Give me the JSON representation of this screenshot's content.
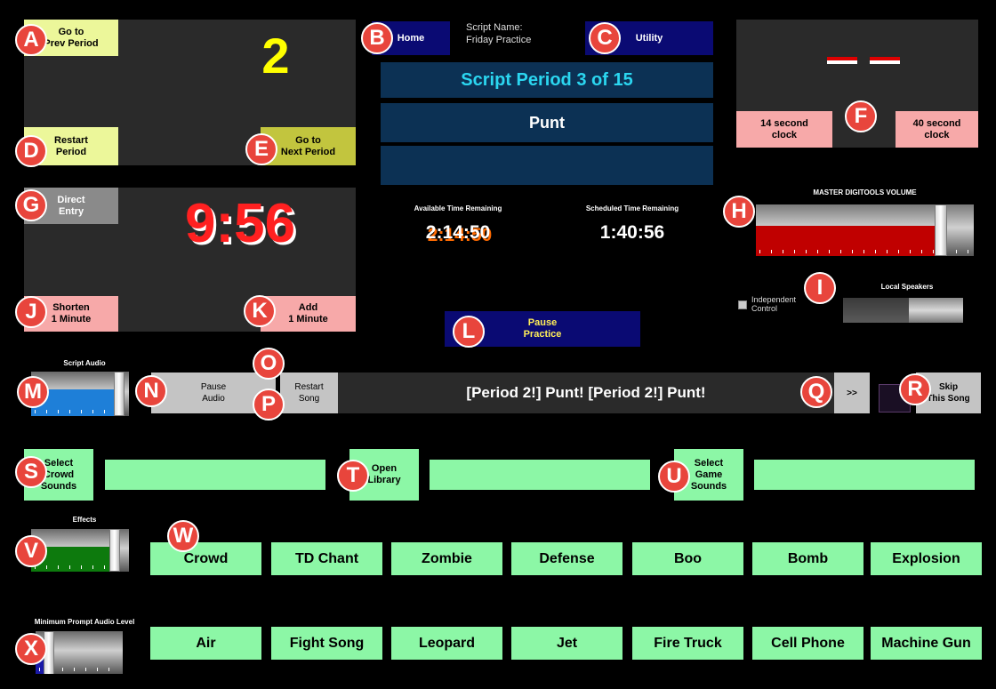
{
  "badges": [
    "A",
    "B",
    "C",
    "D",
    "E",
    "F",
    "G",
    "H",
    "I",
    "J",
    "K",
    "L",
    "M",
    "N",
    "O",
    "P",
    "Q",
    "R",
    "S",
    "T",
    "U",
    "V",
    "W",
    "X"
  ],
  "period": {
    "prev_label": "Go to\nPrev Period",
    "number": "2",
    "restart_label": "Restart\nPeriod",
    "next_label": "Go to\nNext Period"
  },
  "header": {
    "home_label": "Home",
    "script_name_label": "Script Name:",
    "script_name_value": "Friday Practice",
    "utility_label": "Utility"
  },
  "script": {
    "period_text": "Script Period 3 of 15",
    "period_name": "Punt",
    "extra": ""
  },
  "clocks": {
    "dashes": "– –",
    "fourteen_label": "14 second\nclock",
    "forty_label": "40 second\nclock"
  },
  "timer": {
    "direct_entry_label": "Direct\nEntry",
    "value": "9:56",
    "shorten_label": "Shorten\n1 Minute",
    "add_label": "Add\n1 Minute"
  },
  "time_remaining": {
    "available_label": "Available Time Remaining",
    "available_value": "2:14:50",
    "scheduled_label": "Scheduled Time Remaining",
    "scheduled_value": "1:40:56"
  },
  "master_volume": {
    "label": "MASTER DIGITOOLS VOLUME",
    "level": 0.85,
    "color": "#c00000"
  },
  "local_speakers": {
    "label": "Local Speakers",
    "independent_label": "Independent\nControl",
    "checked": false,
    "level": 0.55
  },
  "pause_practice_label": "Pause\nPractice",
  "script_audio": {
    "label": "Script Audio",
    "level": 0.9,
    "color": "#1e7fd8",
    "pause_label": "Pause\nAudio",
    "restart_label": "Restart\nSong",
    "now_playing": "[Period 2!] Punt! [Period 2!] Punt!",
    "next_label": ">>",
    "skip_label": "Skip\nThis Song"
  },
  "libraries": {
    "crowd_label": "Select\nCrowd\nSounds",
    "open_label": "Open\nLibrary",
    "game_label": "Select\nGame\nSounds"
  },
  "effects": {
    "label": "Effects",
    "level": 0.85,
    "color": "#0d7a0d",
    "row1": [
      "Crowd",
      "TD Chant",
      "Zombie",
      "Defense",
      "Boo",
      "Bomb",
      "Explosion"
    ],
    "row2": [
      "Air",
      "Fight Song",
      "Leopard",
      "Jet",
      "Fire Truck",
      "Cell Phone",
      "Machine Gun"
    ]
  },
  "prompt_audio": {
    "label": "Minimum Prompt Audio Level",
    "level": 0.15,
    "color": "#1a1aa8"
  }
}
